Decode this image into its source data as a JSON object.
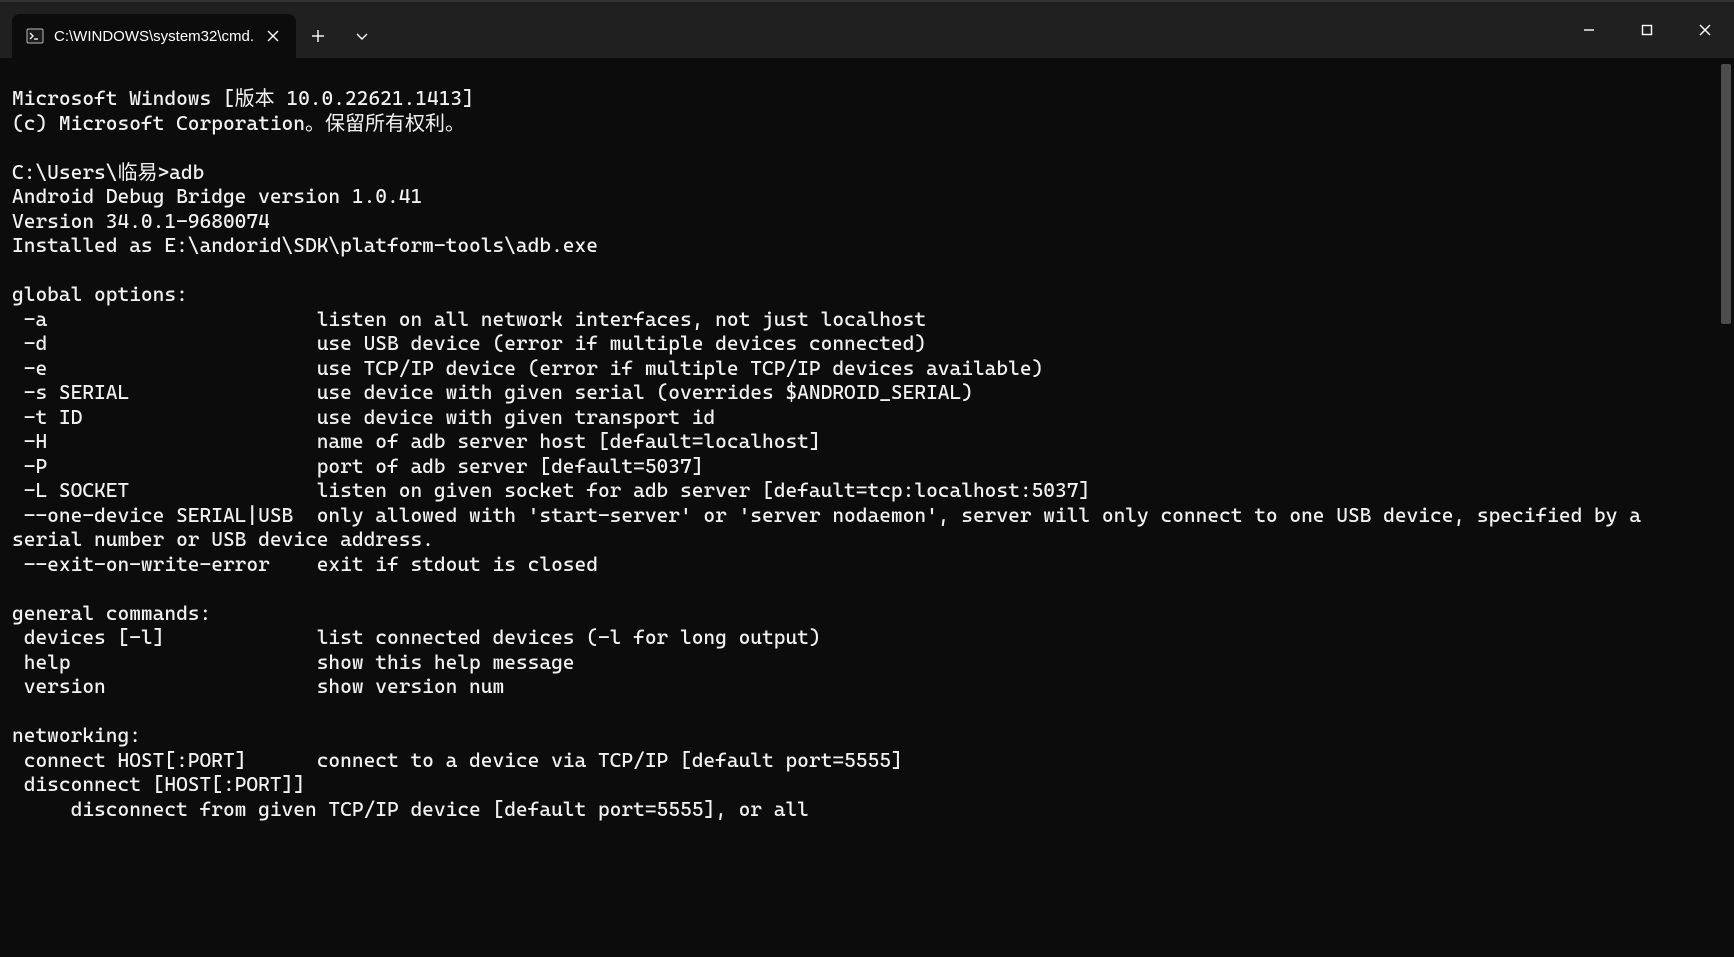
{
  "tab": {
    "title": "C:\\WINDOWS\\system32\\cmd."
  },
  "terminal": {
    "lines": [
      "Microsoft Windows [版本 10.0.22621.1413]",
      "(c) Microsoft Corporation。保留所有权利。",
      "",
      "C:\\Users\\临易>adb",
      "Android Debug Bridge version 1.0.41",
      "Version 34.0.1-9680074",
      "Installed as E:\\andorid\\SDK\\platform-tools\\adb.exe",
      "",
      "global options:",
      " -a                       listen on all network interfaces, not just localhost",
      " -d                       use USB device (error if multiple devices connected)",
      " -e                       use TCP/IP device (error if multiple TCP/IP devices available)",
      " -s SERIAL                use device with given serial (overrides $ANDROID_SERIAL)",
      " -t ID                    use device with given transport id",
      " -H                       name of adb server host [default=localhost]",
      " -P                       port of adb server [default=5037]",
      " -L SOCKET                listen on given socket for adb server [default=tcp:localhost:5037]",
      " --one-device SERIAL|USB  only allowed with 'start-server' or 'server nodaemon', server will only connect to one USB device, specified by a serial number or USB device address.",
      " --exit-on-write-error    exit if stdout is closed",
      "",
      "general commands:",
      " devices [-l]             list connected devices (-l for long output)",
      " help                     show this help message",
      " version                  show version num",
      "",
      "networking:",
      " connect HOST[:PORT]      connect to a device via TCP/IP [default port=5555]",
      " disconnect [HOST[:PORT]]",
      "     disconnect from given TCP/IP device [default port=5555], or all"
    ]
  }
}
